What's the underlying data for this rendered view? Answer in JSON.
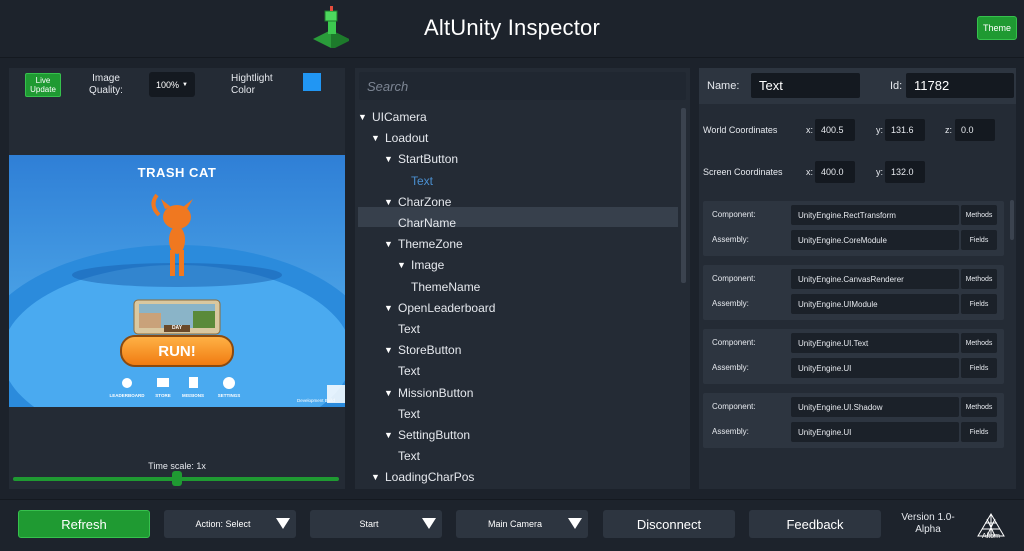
{
  "header": {
    "title": "AltUnity Inspector",
    "theme_button": "Theme",
    "logo_icon": "altunity-cube-logo"
  },
  "toolbar": {
    "live_update": "Live Update",
    "image_quality_label": "Image Quality:",
    "image_quality_value": "100%",
    "highlight_color_label": "Hightlight Color",
    "highlight_color": "#2196f3"
  },
  "game_view": {
    "game_title": "TRASH CAT",
    "theme_tile": "DAY",
    "run_label": "RUN!",
    "menu": [
      "LEADERBOARD",
      "STORE",
      "MISSIONS",
      "SETTINGS"
    ],
    "watermark": "Development Build"
  },
  "time_scale": {
    "label": "Time scale: 1x",
    "value": 1
  },
  "search": {
    "placeholder": "Search"
  },
  "tree": [
    {
      "label": "UICamera",
      "depth": 0,
      "expanded": true
    },
    {
      "label": "Loadout",
      "depth": 1,
      "expanded": true
    },
    {
      "label": "StartButton",
      "depth": 2,
      "expanded": true
    },
    {
      "label": "Text",
      "depth": 3,
      "expanded": null,
      "selected": true
    },
    {
      "label": "CharZone",
      "depth": 2,
      "expanded": true
    },
    {
      "label": "CharName",
      "depth": 2,
      "expanded": null
    },
    {
      "label": "ThemeZone",
      "depth": 2,
      "expanded": true
    },
    {
      "label": "Image",
      "depth": 3,
      "expanded": true
    },
    {
      "label": "ThemeName",
      "depth": 3,
      "expanded": null
    },
    {
      "label": "OpenLeaderboard",
      "depth": 2,
      "expanded": true
    },
    {
      "label": "Text",
      "depth": 2,
      "expanded": null
    },
    {
      "label": "StoreButton",
      "depth": 2,
      "expanded": true
    },
    {
      "label": "Text",
      "depth": 2,
      "expanded": null
    },
    {
      "label": "MissionButton",
      "depth": 2,
      "expanded": true
    },
    {
      "label": "Text",
      "depth": 2,
      "expanded": null
    },
    {
      "label": "SettingButton",
      "depth": 2,
      "expanded": true
    },
    {
      "label": "Text",
      "depth": 2,
      "expanded": null
    },
    {
      "label": "LoadingCharPos",
      "depth": 1,
      "expanded": true
    }
  ],
  "details": {
    "name_label": "Name:",
    "name_value": "Text",
    "id_label": "Id:",
    "id_value": "11782",
    "world_label": "World Coordinates",
    "world": {
      "x": "400.5",
      "y": "131.6",
      "z": "0.0"
    },
    "screen_label": "Screen Coordinates",
    "screen": {
      "x": "400.0",
      "y": "132.0"
    },
    "x_label": "x:",
    "y_label": "y:",
    "z_label": "z:"
  },
  "components_labels": {
    "component": "Component:",
    "assembly": "Assembly:",
    "methods": "Methods",
    "fields": "Fields"
  },
  "components": [
    {
      "component": "UnityEngine.RectTransform",
      "assembly": "UnityEngine.CoreModule"
    },
    {
      "component": "UnityEngine.CanvasRenderer",
      "assembly": "UnityEngine.UIModule"
    },
    {
      "component": "UnityEngine.UI.Text",
      "assembly": "UnityEngine.UI"
    },
    {
      "component": "UnityEngine.UI.Shadow",
      "assembly": "UnityEngine.UI"
    }
  ],
  "footer": {
    "refresh": "Refresh",
    "action": "Action: Select",
    "start": "Start",
    "camera": "Main Camera",
    "disconnect": "Disconnect",
    "feedback": "Feedback",
    "version": "Version 1.0-Alpha",
    "altom": "Altom"
  }
}
